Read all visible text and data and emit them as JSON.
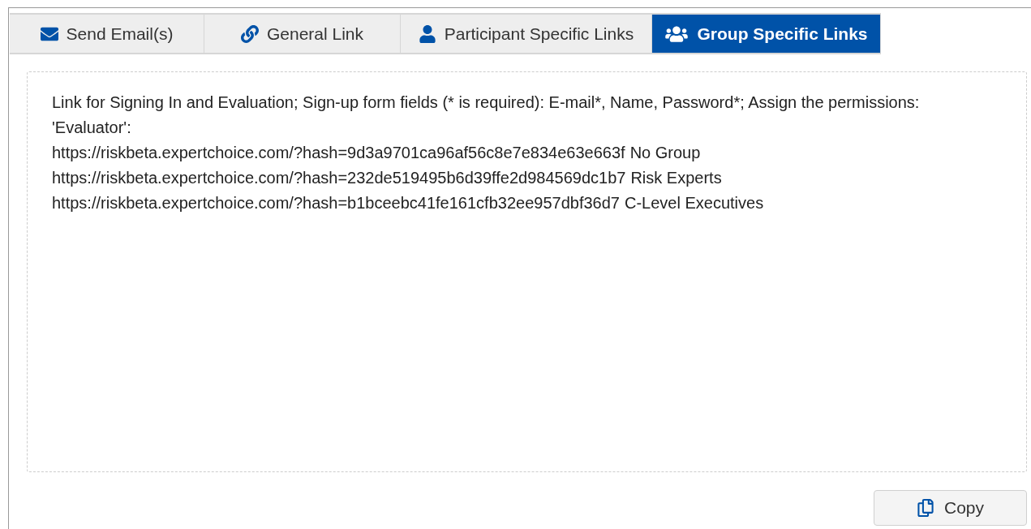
{
  "tabs": [
    {
      "label": "Send Email(s)",
      "kind": "email",
      "selected": false
    },
    {
      "label": "General Link",
      "kind": "link",
      "selected": false
    },
    {
      "label": "Participant Specific Links",
      "kind": "person",
      "selected": false
    },
    {
      "label": "Group Specific Links",
      "kind": "group",
      "selected": true
    }
  ],
  "content": {
    "intro": "Link for Signing In and Evaluation; Sign-up form fields (* is required): E-mail*, Name, Password*; Assign the permissions: 'Evaluator':",
    "links": [
      {
        "url": "https://riskbeta.expertchoice.com/?hash=9d3a9701ca96af56c8e7e834e63e663f",
        "group": "No Group"
      },
      {
        "url": "https://riskbeta.expertchoice.com/?hash=232de519495b6d39ffe2d984569dc1b7",
        "group": "Risk Experts"
      },
      {
        "url": "https://riskbeta.expertchoice.com/?hash=b1bceebc41fe161cfb32ee957dbf36d7",
        "group": "C-Level Executives"
      }
    ]
  },
  "copy_button": {
    "label": "Copy"
  }
}
